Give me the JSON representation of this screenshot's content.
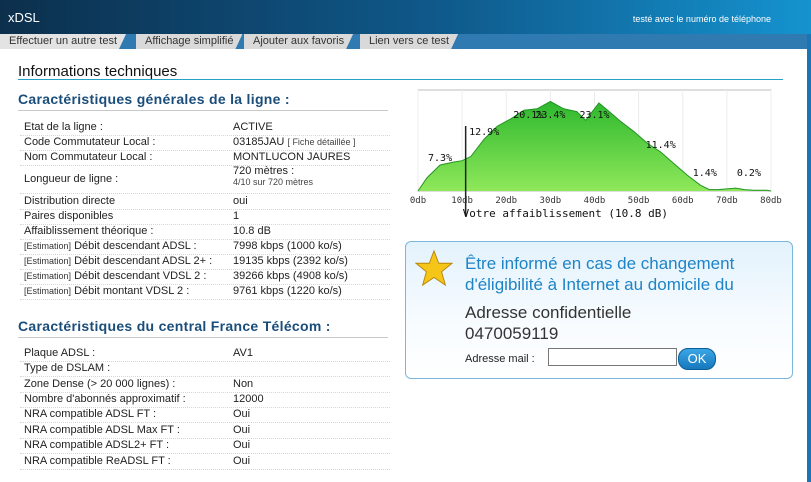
{
  "app": {
    "brand": "xDSL",
    "tagline": "testé avec le numéro de téléphone"
  },
  "menu": {
    "tab1": "Effectuer un autre test",
    "tab2": "Affichage simplifié",
    "tab3": "Ajouter aux favoris",
    "tab4": "Lien vers ce test"
  },
  "page": {
    "title": "Informations techniques"
  },
  "line": {
    "heading": "Caractéristiques générales de la ligne :",
    "etat": {
      "label": "Etat de la ligne :",
      "value": "ACTIVE"
    },
    "code": {
      "label": "Code Commutateur Local :",
      "value": "03185JAU",
      "detail": "[ Fiche détaillée ]"
    },
    "nom": {
      "label": "Nom Commutateur Local :",
      "value": "MONTLUCON JAURES"
    },
    "longueur": {
      "label": "Longueur de ligne :",
      "value": "720 mètres :",
      "sub": "4/10 sur 720 mètres"
    },
    "distribution": {
      "label": "Distribution directe",
      "value": "oui"
    },
    "paires": {
      "label": "Paires disponibles",
      "value": "1"
    },
    "affaiblissement": {
      "label": "Affaiblissement théorique :",
      "value": "10.8 dB"
    },
    "est_tag": "[Estimation]",
    "adsl": {
      "label": "Débit descendant ADSL :",
      "value": "7998 kbps (1000 ko/s)"
    },
    "adsl2": {
      "label": "Débit descendant ADSL 2+ :",
      "value": "19135 kbps (2392 ko/s)"
    },
    "vdsl": {
      "label": "Débit descendant VDSL 2 :",
      "value": "39266 kbps (4908 ko/s)"
    },
    "montant": {
      "label": "Débit montant VDSL 2 :",
      "value": "9761 kbps (1220 ko/s)"
    }
  },
  "central": {
    "heading": "Caractéristiques du central France Télécom :",
    "plaque": {
      "label": "Plaque ADSL :",
      "value": "AV1"
    },
    "dslam": {
      "label": "Type de DSLAM :",
      "value": ""
    },
    "zone": {
      "label": "Zone Dense (> 20 000 lignes) :",
      "value": "Non"
    },
    "abonnes": {
      "label": "Nombre d'abonnés approximatif :",
      "value": "12000"
    },
    "nra_adsl": {
      "label": "NRA compatible ADSL FT :",
      "value": "Oui"
    },
    "nra_max": {
      "label": "NRA compatible ADSL Max FT :",
      "value": "Oui"
    },
    "nra_adsl2": {
      "label": "NRA compatible ADSL2+ FT :",
      "value": "Oui"
    },
    "nra_readsl": {
      "label": "NRA compatible ReADSL FT :",
      "value": "Oui"
    }
  },
  "chart_data": {
    "type": "area",
    "x": [
      0,
      10,
      20,
      30,
      40,
      50,
      60,
      70,
      80
    ],
    "tick_labels": [
      "0db",
      "10db",
      "20db",
      "30db",
      "40db",
      "50db",
      "60db",
      "70db",
      "80db"
    ],
    "line_percent_points": [
      {
        "x": 5,
        "label": "7.3%"
      },
      {
        "x": 15,
        "label": "12.9%"
      },
      {
        "x": 25,
        "label": "20.1%"
      },
      {
        "x": 30,
        "label": "23.4%"
      },
      {
        "x": 40,
        "label": "23.1%"
      },
      {
        "x": 55,
        "label": "11.4%"
      },
      {
        "x": 65,
        "label": "1.4%"
      },
      {
        "x": 75,
        "label": "0.2%"
      }
    ],
    "curve": [
      [
        0,
        0
      ],
      [
        2,
        9
      ],
      [
        5,
        18
      ],
      [
        8,
        20
      ],
      [
        10,
        21
      ],
      [
        12,
        24
      ],
      [
        15,
        36
      ],
      [
        18,
        45
      ],
      [
        21,
        50
      ],
      [
        24,
        56
      ],
      [
        27,
        57
      ],
      [
        30,
        62
      ],
      [
        33,
        57
      ],
      [
        36,
        55
      ],
      [
        38,
        49
      ],
      [
        41,
        61
      ],
      [
        43,
        56
      ],
      [
        46,
        48
      ],
      [
        49,
        41
      ],
      [
        52,
        33
      ],
      [
        55,
        27
      ],
      [
        58,
        19
      ],
      [
        61,
        11
      ],
      [
        64,
        4
      ],
      [
        66,
        1
      ],
      [
        68,
        1
      ],
      [
        72,
        2
      ],
      [
        74,
        1
      ],
      [
        76,
        0.5
      ],
      [
        79,
        0.5
      ],
      [
        80,
        0
      ]
    ],
    "ylim": [
      0,
      70
    ],
    "xlim": [
      0,
      80
    ],
    "marker": {
      "x": 10.8,
      "label": "Votre affaiblissement (10.8 dB)"
    },
    "colors": {
      "fill_top": "#2eb82e",
      "fill_bottom": "#8fe85a",
      "stroke": "#239423",
      "marker": "#222222"
    }
  },
  "alert": {
    "title": "Être informé en cas de changement d'éligibilité à Internet au domicile du",
    "address": "Adresse confidentielle",
    "phone": "0470059119",
    "mail_label": "Adresse mail :",
    "mail_value": "",
    "ok": "OK",
    "star_color": "#f5c518"
  }
}
